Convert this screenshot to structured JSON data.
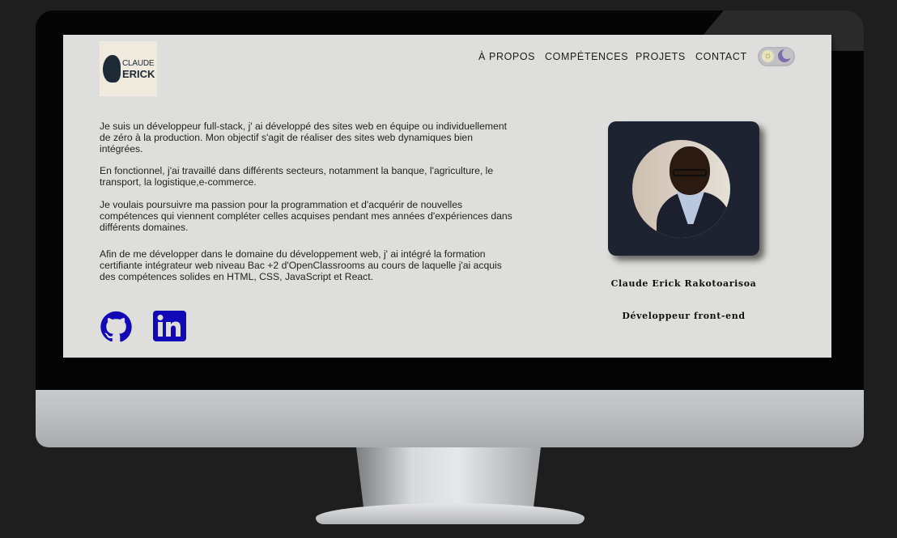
{
  "logo": {
    "line1": "CLAUDE",
    "line2": "ERICK"
  },
  "nav": {
    "items": [
      {
        "label": "À PROPOS"
      },
      {
        "label": "COMPÉTENCES"
      },
      {
        "label": "PROJETS"
      },
      {
        "label": "CONTACT"
      }
    ]
  },
  "theme_toggle": {
    "sun_icon": "sun-icon",
    "moon_icon": "moon-icon"
  },
  "bio": {
    "p1": "Je suis un développeur full-stack, j' ai développé des sites web en équipe ou individuellement de zéro à la production. Mon objectif s'agit de réaliser des sites web dynamiques bien intégrées.",
    "p2": "En fonctionnel, j'ai travaillé dans différents secteurs, notamment la banque, l'agriculture, le transport, la logistique,e-commerce.",
    "p3": "Je voulais poursuivre ma passion pour la programmation et d'acquérir de nouvelles compétences qui viennent compléter celles acquises pendant mes années d'expériences dans différents domaines.",
    "p4": "Afin de me développer dans le domaine du développement web, j' ai intégré la formation certifiante intégrateur web niveau Bac +2 d'OpenClassrooms au cours de laquelle j'ai acquis des compétences solides en HTML, CSS, JavaScript et React."
  },
  "social": {
    "github_icon": "github-icon",
    "linkedin_icon": "linkedin-icon",
    "icon_color": "#1208b7"
  },
  "profile": {
    "name": "Claude Erick Rakotoarisoa",
    "role": "Développeur front-end"
  }
}
